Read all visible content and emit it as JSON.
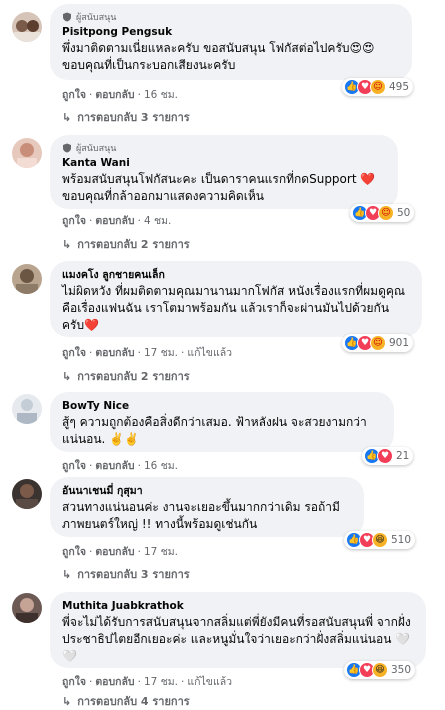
{
  "labels": {
    "like": "ถูกใจ",
    "reply": "ตอบกลับ",
    "edited": "แก้ไขแล้ว",
    "supporter": "ผู้สนับสนุน",
    "view_replies_prefix": "การตอบกลับ"
  },
  "comments": [
    {
      "author": "Pisitpong Pengsuk",
      "badge": "ผู้สนับสนุน",
      "text": "พึ่งมาติดตามเนี่ยแหละครับ ขอสนับสนุน โฟกัสต่อไปครับ😍😍 ขอบคุณที่เป็นกระบอกเสียงนะครับ",
      "time": "16 ชม.",
      "edited": "",
      "reactions": [
        "like",
        "love",
        "care"
      ],
      "reaction_count": "495",
      "replies": "การตอบกลับ 3 รายการ"
    },
    {
      "author": "Kanta Wani",
      "badge": "ผู้สนับสนุน",
      "text": "พร้อมสนับสนุนโฟกัสนะคะ เป็นดาราคนแรกที่กดSupport ❤️ ขอบคุณที่กล้าออกมาแสดงความคิดเห็น",
      "time": "4 ชม.",
      "edited": "",
      "reactions": [
        "like",
        "love",
        "care"
      ],
      "reaction_count": "50",
      "replies": "การตอบกลับ 2 รายการ"
    },
    {
      "author": "แมงคโง ลูกชายคนเล็ก",
      "badge": "",
      "text": "ไม่ผิดหวัง ที่ผมติดตามคุณมานานมากโฟกัส หนังเรื่องแรกที่ผมดูคุณคือเรื่องแฟนฉัน เราโตมาพร้อมกัน แล้วเราก็จะผ่านมันไปด้วยกันครับ❤️",
      "time": "17 ชม.",
      "edited": "แก้ไขแล้ว",
      "reactions": [
        "like",
        "love",
        "care"
      ],
      "reaction_count": "901",
      "replies": "การตอบกลับ 2 รายการ"
    },
    {
      "author": "BowTy Nice",
      "badge": "",
      "text": "สู้ๆ ความถูกต้องคือสิ่งดีกว่าเสมอ. ฟ้าหลังฝน จะสวยงามกว่าแน่นอน. ✌️✌️",
      "time": "16 ชม.",
      "edited": "",
      "reactions": [
        "like",
        "love"
      ],
      "reaction_count": "21",
      "replies": ""
    },
    {
      "author": "อันนาเชนมี่ กุสุมา",
      "badge": "",
      "text": "สวนทางแน่นอนค่ะ งานจะเยอะขึ้นมากกว่าเดิม รอถ้ามีภาพยนตร์ใหญ่ !! ทางนี้พร้อมดูเช่นกัน",
      "time": "17 ชม.",
      "edited": "",
      "reactions": [
        "like",
        "love",
        "haha"
      ],
      "reaction_count": "510",
      "replies": "การตอบกลับ 3 รายการ"
    },
    {
      "author": "Muthita Juabkrathok",
      "badge": "",
      "text": "พี่จะไม่ได้รับการสนับสนุนจากสลิ่มแต่พี่ยังมีคนที่รอสนับสนุนพี่ จากฝั่งประชาธิปไตยอีกเยอะค่ะ และหนูมั่นใจว่าเยอะกว่าฝั่งสลิ่มแน่นอน 🤍🤍",
      "time": "17 ชม.",
      "edited": "แก้ไขแล้ว",
      "reactions": [
        "like",
        "love",
        "haha"
      ],
      "reaction_count": "350",
      "replies": "การตอบกลับ 4 รายการ"
    }
  ]
}
